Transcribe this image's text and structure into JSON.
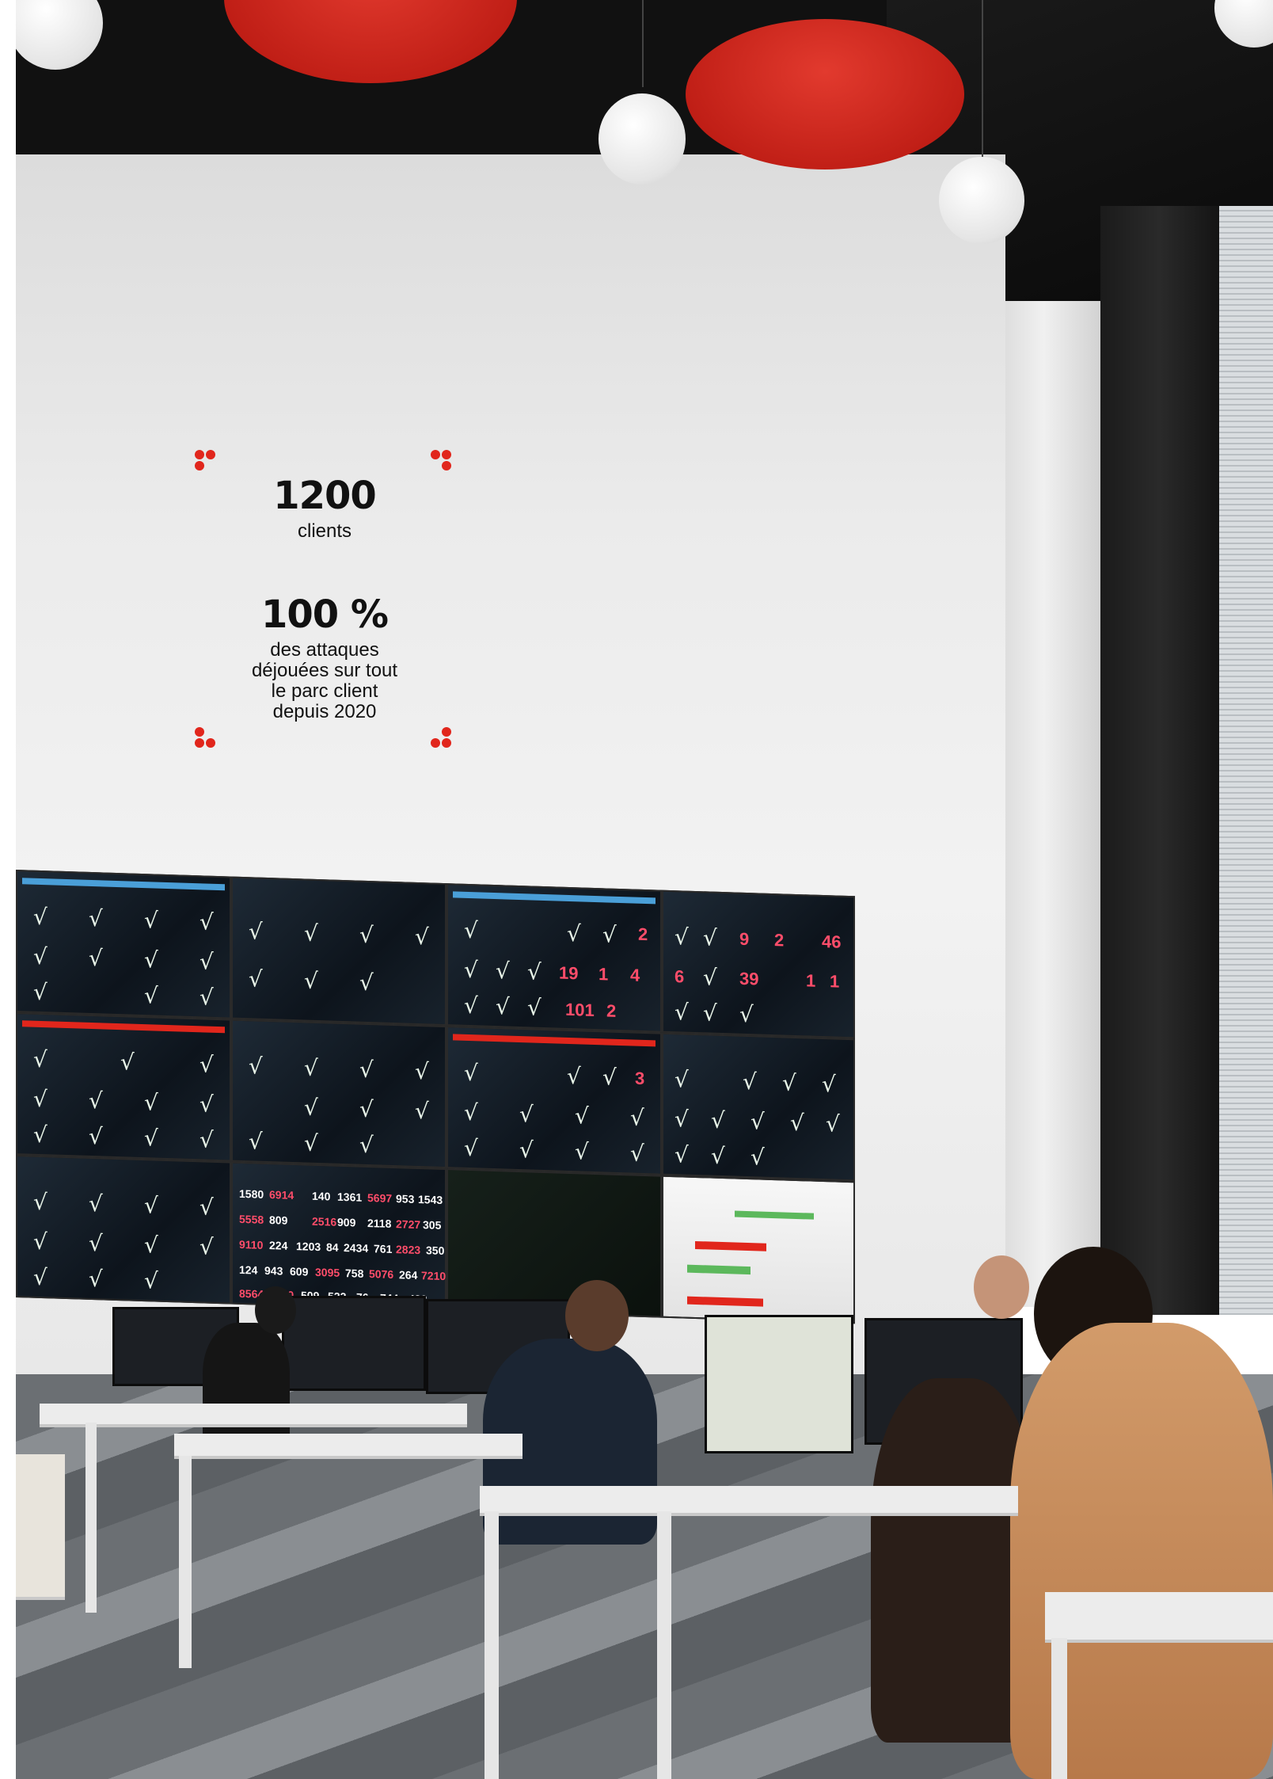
{
  "stats": [
    {
      "value": "1200",
      "label": "clients"
    },
    {
      "value": "100 %",
      "label_lines": [
        "des attaques",
        "déjouées sur tout",
        "le parc client",
        "depuis 2020"
      ]
    }
  ],
  "colors": {
    "accent_red": "#e1261c",
    "text": "#111111"
  },
  "screen_numbers": {
    "panel_c1": [
      "2",
      "19",
      "1",
      "4",
      "101",
      "2"
    ],
    "panel_d1": [
      "9",
      "2",
      "46",
      "6",
      "39",
      "1",
      "1"
    ],
    "panel_c2": [
      "3"
    ],
    "panel_b3_row1": [
      "1580",
      "6914",
      "140",
      "1361",
      "5697",
      "953",
      "1543"
    ],
    "panel_b3_row2": [
      "5558",
      "809",
      "2516",
      "909",
      "2118",
      "2727",
      "305"
    ],
    "panel_b3_row3": [
      "9110",
      "224",
      "1203",
      "84",
      "2434",
      "761",
      "2823",
      "350"
    ],
    "panel_b3_row4": [
      "124",
      "943",
      "609",
      "3095",
      "758",
      "5076",
      "264",
      "7210"
    ],
    "panel_b3_row5": [
      "8564",
      "2550",
      "509",
      "522",
      "76",
      "744",
      "422"
    ]
  }
}
